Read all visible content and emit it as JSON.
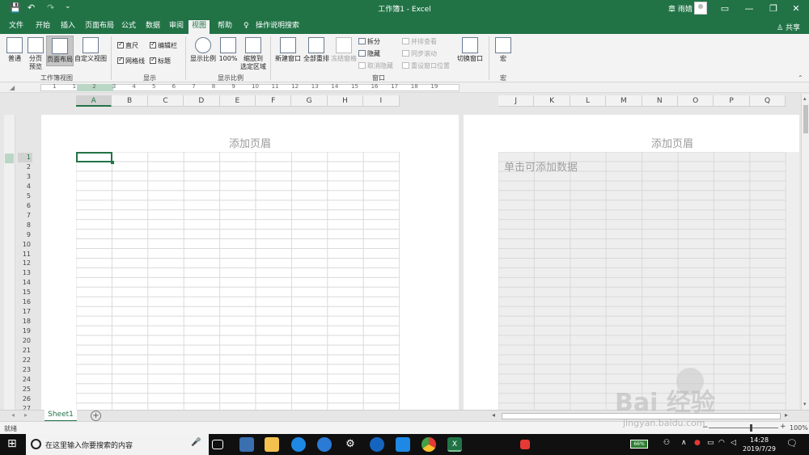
{
  "titlebar": {
    "title": "工作簿1 - Excel",
    "user": "章 雨婧",
    "save_icon": "💾",
    "undo_icon": "↶",
    "redo_icon": "↷",
    "customize": "⌄",
    "ribbon_opts": "▭",
    "minimize": "—",
    "restore": "❐",
    "close": "✕"
  },
  "tabs": {
    "items": [
      "文件",
      "开始",
      "插入",
      "页面布局",
      "公式",
      "数据",
      "审阅",
      "视图",
      "帮助"
    ],
    "active": "视图",
    "search": "操作说明搜索",
    "share": "共享",
    "share_icon": "♙",
    "search_icon": "♀"
  },
  "ribbon": {
    "views": {
      "normal": "普通",
      "page_break_1": "分页",
      "page_break_2": "预览",
      "page_layout": "页面布局",
      "custom": "自定义视图",
      "label": "工作簿视图"
    },
    "show": {
      "ruler": "直尺",
      "formula_bar": "编辑栏",
      "gridlines": "网格线",
      "headings": "标题",
      "label": "显示"
    },
    "zoom": {
      "zoom": "显示比例",
      "hundred": "100%",
      "to_selection_1": "缩放到",
      "to_selection_2": "选定区域",
      "label": "显示比例"
    },
    "window": {
      "new_window": "新建窗口",
      "arrange_all": "全部重排",
      "freeze": "冻结窗格",
      "split": "拆分",
      "hide": "隐藏",
      "unhide": "取消隐藏",
      "side_by_side": "并排查看",
      "sync_scroll": "同步滚动",
      "reset_pos": "重设窗口位置",
      "switch": "切换窗口",
      "label": "窗口"
    },
    "macros": {
      "macro": "宏",
      "label": "宏"
    }
  },
  "ruler_numbers": [
    "1",
    "1",
    "2",
    "3",
    "4",
    "5",
    "6",
    "7",
    "8",
    "9",
    "10",
    "11",
    "12",
    "13",
    "14",
    "15",
    "16",
    "17",
    "18",
    "19"
  ],
  "columns_left": [
    "A",
    "B",
    "C",
    "D",
    "E",
    "F",
    "G",
    "H",
    "I"
  ],
  "columns_right": [
    "J",
    "K",
    "L",
    "M",
    "N",
    "O",
    "P",
    "Q"
  ],
  "rows": [
    "1",
    "2",
    "3",
    "4",
    "5",
    "6",
    "7",
    "8",
    "9",
    "10",
    "11",
    "12",
    "13",
    "14",
    "15",
    "16",
    "17",
    "18",
    "19",
    "20",
    "21",
    "22",
    "23",
    "24",
    "25",
    "26",
    "27"
  ],
  "page": {
    "header_left": "添加页眉",
    "header_right": "添加页眉",
    "click_hint": "单击可添加数据"
  },
  "sheetbar": {
    "sheet": "Sheet1",
    "add": "+",
    "nav_prev": "◂",
    "nav_next": "▸"
  },
  "status": {
    "ready": "就绪",
    "zoom": "100%",
    "zoom_minus": "−",
    "zoom_plus": "+"
  },
  "taskbar": {
    "search_placeholder": "在这里输入你要搜索的内容",
    "time": "14:28",
    "date": "2019/7/29",
    "battery": "66%",
    "start_icon": "⊞",
    "mic_icon": "🎤",
    "notify_icon": "🗨"
  },
  "watermark": {
    "text": "Bai 经验",
    "sub": "jingyan.baidu.com"
  }
}
